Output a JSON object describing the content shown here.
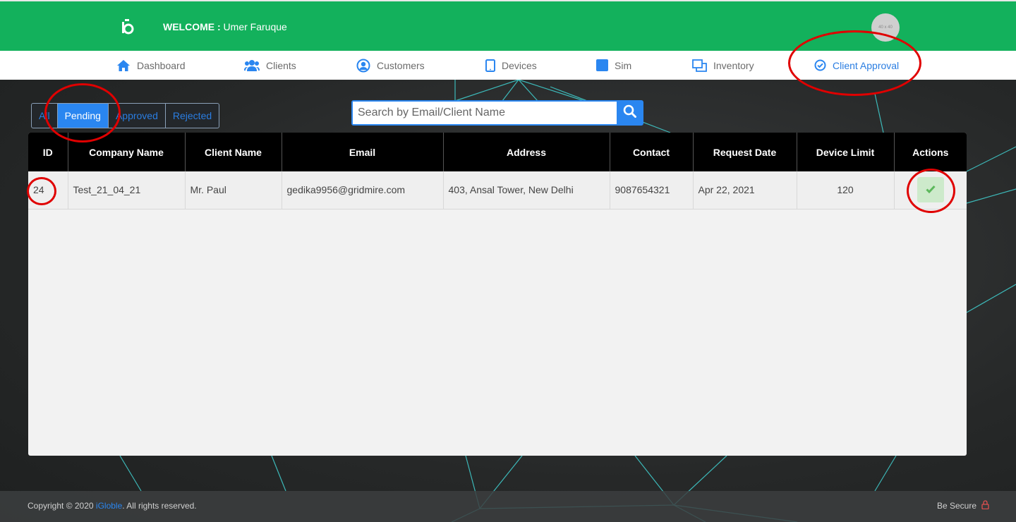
{
  "header": {
    "welcome_label": "WELCOME :",
    "user_name": "Umer Faruque",
    "avatar_text": "40 x 40"
  },
  "nav": {
    "items": [
      {
        "label": "Dashboard",
        "icon": "home-icon"
      },
      {
        "label": "Clients",
        "icon": "users-icon"
      },
      {
        "label": "Customers",
        "icon": "user-circle-icon"
      },
      {
        "label": "Devices",
        "icon": "tablet-icon"
      },
      {
        "label": "Sim",
        "icon": "sim-square-icon"
      },
      {
        "label": "Inventory",
        "icon": "copy-icon"
      },
      {
        "label": "Client Approval",
        "icon": "check-circle-icon"
      }
    ],
    "active": "Client Approval"
  },
  "filters": {
    "items": [
      "All",
      "Pending",
      "Approved",
      "Rejected"
    ],
    "active": "Pending"
  },
  "search": {
    "placeholder": "Search by Email/Client Name",
    "value": ""
  },
  "table": {
    "columns": [
      "ID",
      "Company Name",
      "Client Name",
      "Email",
      "Address",
      "Contact",
      "Request Date",
      "Device Limit",
      "Actions"
    ],
    "rows": [
      {
        "id": "24",
        "company_name": "Test_21_04_21",
        "client_name": "Mr. Paul",
        "email": "gedika9956@gridmire.com",
        "address": "403, Ansal Tower, New Delhi",
        "contact": "9087654321",
        "request_date": "Apr 22, 2021",
        "device_limit": "120"
      }
    ]
  },
  "footer": {
    "copyright_prefix": "Copyright © 2020 ",
    "brand": "iGloble",
    "copyright_suffix": ". All rights reserved.",
    "secure_label": "Be Secure"
  },
  "colors": {
    "header_green": "#13b15c",
    "accent_blue": "#2a86f0",
    "approve_green": "#5cb85c",
    "annotation_red": "#e00000"
  }
}
